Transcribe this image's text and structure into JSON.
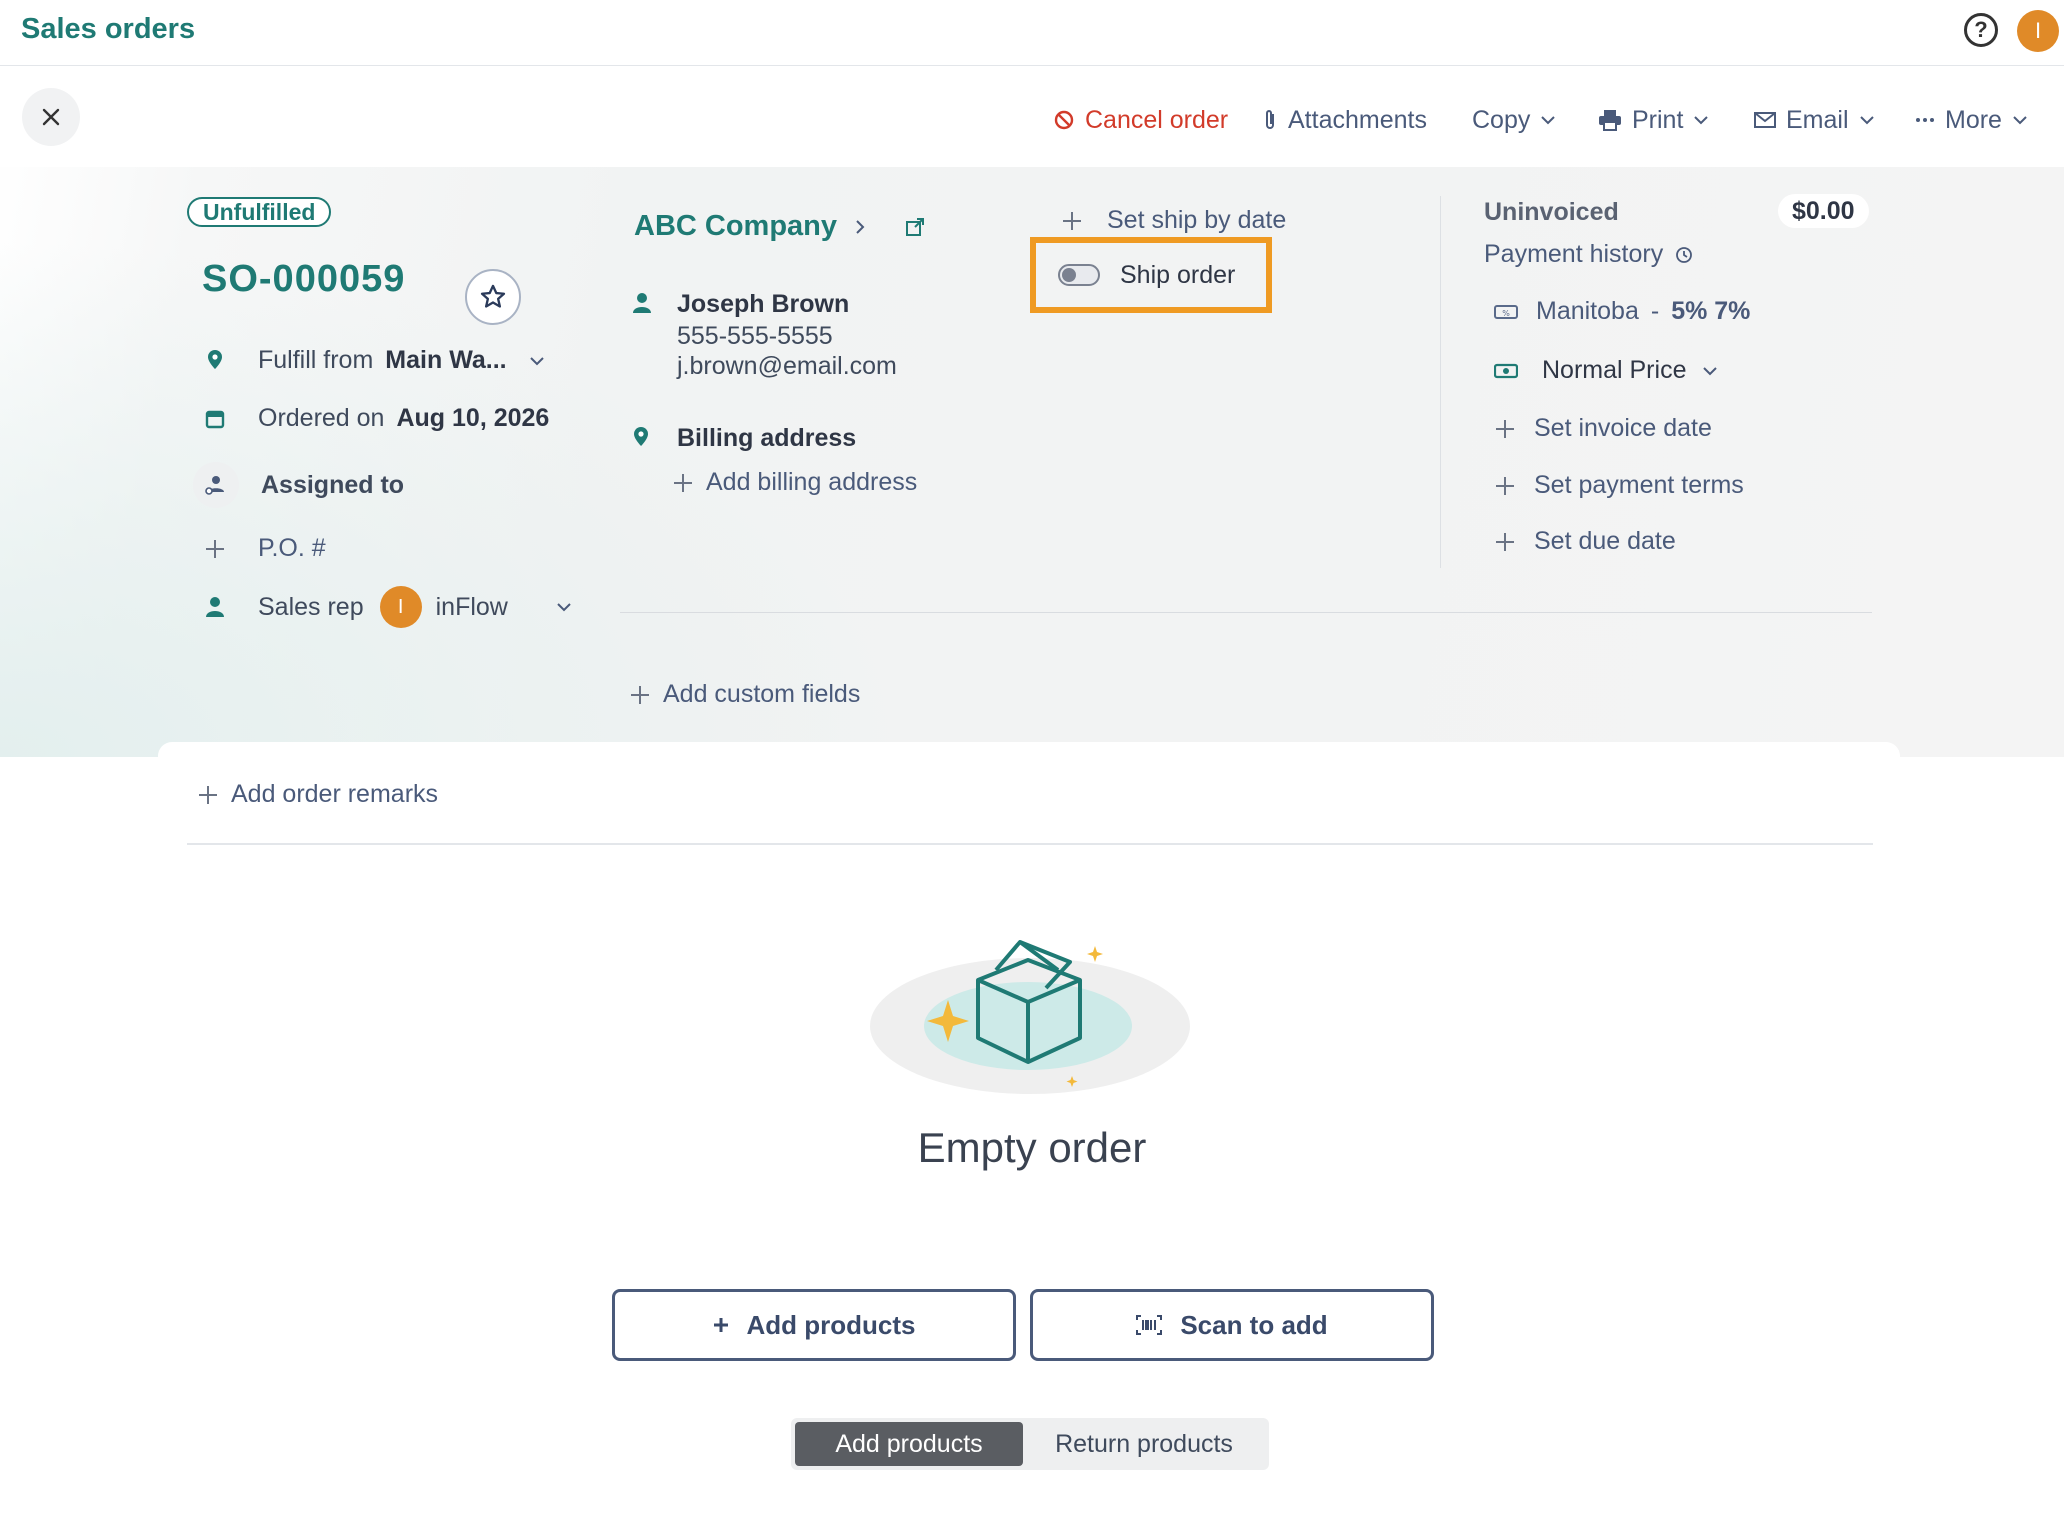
{
  "header": {
    "app_title": "Sales orders",
    "help_glyph": "?",
    "user_initial": "I"
  },
  "toolbar": {
    "cancel_label": "Cancel order",
    "attachments_label": "Attachments",
    "copy_label": "Copy",
    "print_label": "Print",
    "email_label": "Email",
    "more_label": "More"
  },
  "order": {
    "status": "Unfulfilled",
    "number": "SO-000059",
    "fulfill_label": "Fulfill from",
    "fulfill_value": "Main Wa...",
    "ordered_label": "Ordered on",
    "ordered_value": "Aug 10, 2026",
    "assigned_label": "Assigned to",
    "po_label": "P.O. #",
    "sales_rep_label": "Sales rep",
    "sales_rep_initial": "I",
    "sales_rep_value": "inFlow"
  },
  "customer": {
    "company": "ABC Company",
    "contact_name": "Joseph Brown",
    "phone": "555-555-5555",
    "email": "j.brown@email.com",
    "billing_label": "Billing address",
    "add_billing_label": "Add billing address",
    "add_custom_fields_label": "Add custom fields"
  },
  "shipping": {
    "set_ship_by_label": "Set ship by date",
    "ship_order_label": "Ship order",
    "ship_order_enabled": false
  },
  "invoice": {
    "status_label": "Uninvoiced",
    "amount": "$0.00",
    "payment_history_label": "Payment history",
    "tax_region": "Manitoba",
    "tax_sep": "-",
    "tax_rates": "5% 7%",
    "pricing": "Normal Price",
    "set_invoice_date_label": "Set invoice date",
    "set_payment_terms_label": "Set payment terms",
    "set_due_date_label": "Set due date"
  },
  "lines": {
    "add_remarks_label": "Add order remarks",
    "empty_title": "Empty order",
    "add_products_button": "Add products",
    "scan_button": "Scan to add",
    "mode_add": "Add products",
    "mode_return": "Return products"
  },
  "colors": {
    "brand": "#1f7a74",
    "danger": "#d23b2a",
    "link": "#4a5a7a",
    "highlight": "#ef9a22",
    "avatar": "#e08a28"
  },
  "icons": {
    "close": "x-icon",
    "star": "star-icon",
    "location": "location-pin-icon",
    "calendar": "calendar-icon",
    "assigned": "team-icon",
    "person": "person-icon",
    "external": "external-link-icon",
    "history": "clock-icon",
    "tax": "tax-tag-icon",
    "price": "cash-icon",
    "barcode": "barcode-icon"
  }
}
